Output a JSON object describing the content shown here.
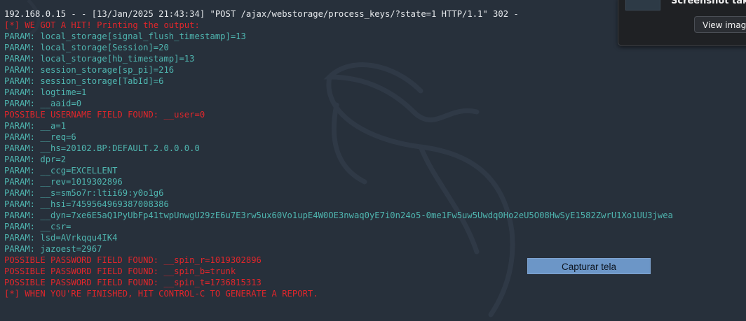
{
  "terminal": {
    "lines": [
      {
        "text": "192.168.0.15 - - [13/Jan/2025 21:43:34] \"POST /ajax/webstorage/process_keys/?state=1 HTTP/1.1\" 302 -",
        "style": "white"
      },
      {
        "text": "[*] WE GOT A HIT! Printing the output:",
        "style": "red"
      },
      {
        "text": "PARAM: local_storage[signal_flush_timestamp]=13",
        "style": "cyan"
      },
      {
        "text": "PARAM: local_storage[Session]=20",
        "style": "cyan"
      },
      {
        "text": "PARAM: local_storage[hb_timestamp]=13",
        "style": "cyan"
      },
      {
        "text": "PARAM: session_storage[sp_pi]=216",
        "style": "cyan"
      },
      {
        "text": "PARAM: session_storage[TabId]=6",
        "style": "cyan"
      },
      {
        "text": "PARAM: logtime=1",
        "style": "cyan"
      },
      {
        "text": "PARAM: __aaid=0",
        "style": "cyan"
      },
      {
        "text": "POSSIBLE USERNAME FIELD FOUND: __user=0",
        "style": "red"
      },
      {
        "text": "PARAM: __a=1",
        "style": "cyan"
      },
      {
        "text": "PARAM: __req=6",
        "style": "cyan"
      },
      {
        "text": "PARAM: __hs=20102.BP:DEFAULT.2.0.0.0.0",
        "style": "cyan"
      },
      {
        "text": "PARAM: dpr=2",
        "style": "cyan"
      },
      {
        "text": "PARAM: __ccg=EXCELLENT",
        "style": "cyan"
      },
      {
        "text": "PARAM: __rev=1019302896",
        "style": "cyan"
      },
      {
        "text": "PARAM: __s=sm5o7r:ltii69:y0o1g6",
        "style": "cyan"
      },
      {
        "text": "PARAM: __hsi=7459564969387008386",
        "style": "cyan"
      },
      {
        "text": "PARAM: __dyn=7xe6E5aQ1PyUbFp41twpUnwgU29zE6u7E3rw5ux60Vo1upE4W0OE3nwaq0yE7i0n24o5-0me1Fw5uw5Uwdq0Ho2eU5O08HwSyE1582ZwrU1Xo1UU3jwea",
        "style": "cyan"
      },
      {
        "text": "PARAM: __csr=",
        "style": "cyan"
      },
      {
        "text": "PARAM: lsd=AVrkqqu4IK4",
        "style": "cyan"
      },
      {
        "text": "PARAM: jazoest=2967",
        "style": "cyan"
      },
      {
        "text": "POSSIBLE PASSWORD FIELD FOUND: __spin_r=1019302896",
        "style": "red"
      },
      {
        "text": "POSSIBLE PASSWORD FIELD FOUND: __spin_b=trunk",
        "style": "red"
      },
      {
        "text": "POSSIBLE PASSWORD FIELD FOUND: __spin_t=1736815313",
        "style": "red"
      },
      {
        "text": "[*] WHEN YOU'RE FINISHED, HIT CONTROL-C TO GENERATE A REPORT.",
        "style": "red"
      }
    ]
  },
  "notification": {
    "title": "Screenshot take",
    "button_label": "View image"
  },
  "capture_button": {
    "label": "Capturar tela"
  },
  "colors": {
    "background": "#27303b",
    "text_white": "#e6e9ec",
    "text_cyan": "#4fb6b0",
    "text_red": "#e0262b",
    "capture_button_bg": "#6c96c7"
  }
}
